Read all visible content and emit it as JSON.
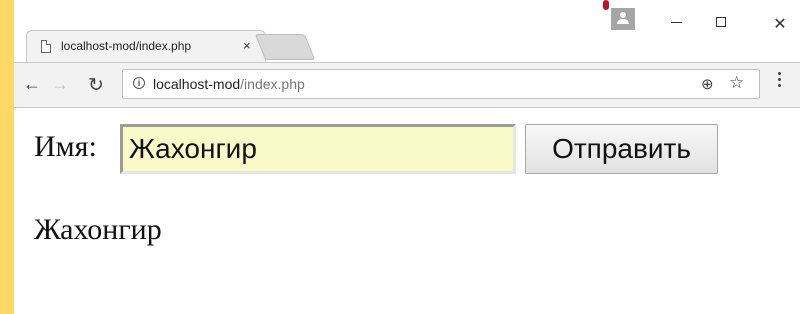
{
  "browser": {
    "tab_title": "localhost-mod/index.php",
    "tab_close": "×",
    "url_host": "localhost-mod",
    "url_path": "/index.php",
    "icons": {
      "back": "back-arrow-icon",
      "forward": "forward-arrow-icon",
      "reload": "reload-icon",
      "info": "info-icon",
      "zoom": "zoom-icon",
      "bookmark": "star-icon",
      "menu": "menu-icon",
      "profile": "profile-icon"
    }
  },
  "form": {
    "label": "Имя:",
    "input_value": "Жахонгир",
    "submit_label": "Отправить"
  },
  "output": {
    "text": "Жахонгир"
  },
  "colors": {
    "desktop": "#ffd966",
    "input_autofill": "#fafac8",
    "profile_badge": "#c0102a"
  }
}
